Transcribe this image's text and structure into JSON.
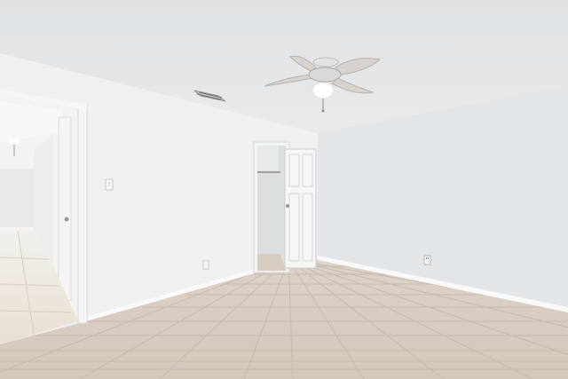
{
  "scene": {
    "kind": "photo",
    "subject": "empty room",
    "elements": [
      "ceiling-fan-icon",
      "light-switch-icon",
      "ac-vent-icon",
      "outlet-icon",
      "closet-door",
      "hallway-doorway"
    ]
  },
  "colors": {
    "ceiling": "#e3e6e8",
    "left_wall": "#eef0f1",
    "back_wall": "#e6e9eb",
    "right_wall": "#e2e5e7",
    "baseboard": "#f8f8f8",
    "floor_tile": "#d9cdc1",
    "grout": "#c3b6a9",
    "door": "#f3f4f5",
    "fan_blade": "#d6d1cd"
  }
}
